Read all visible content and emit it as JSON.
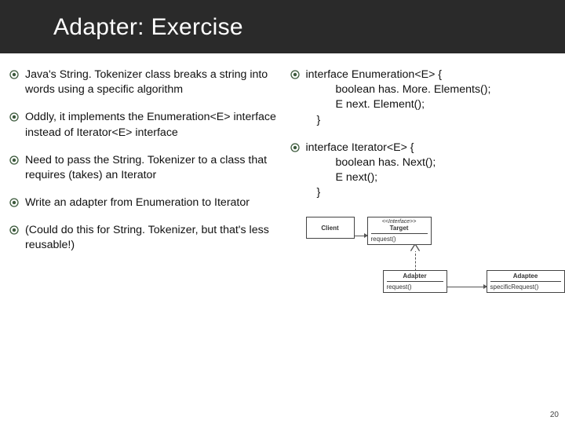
{
  "header": {
    "title": "Adapter: Exercise"
  },
  "left": {
    "items": [
      "Java's String. Tokenizer class breaks a string into words using a specific algorithm",
      "Oddly, it implements the Enumeration<E> interface instead of Iterator<E> interface",
      "Need to pass the String. Tokenizer to a class that requires (takes) an Iterator",
      "Write an adapter from Enumeration to Iterator",
      "(Could do this for String. Tokenizer, but that's less reusable!)"
    ]
  },
  "right": {
    "enum": {
      "sig": "interface Enumeration<E> {",
      "line1": "boolean has. More. Elements();",
      "line2": "E next. Element();",
      "close": "}"
    },
    "iter": {
      "sig": "interface Iterator<E> {",
      "line1": "boolean has. Next();",
      "line2": "E next();",
      "close": "}"
    }
  },
  "diagram": {
    "client": "Client",
    "target_stereo": "<<Interface>>",
    "target": "Target",
    "target_method": "request()",
    "adapter": "Adapter",
    "adapter_method": "request()",
    "adaptee": "Adaptee",
    "adaptee_method": "specificRequest()"
  },
  "slide_number": "20",
  "icons": {
    "bullet_outer": "#3c5a3c",
    "bullet_inner": "#3c5a3c"
  }
}
